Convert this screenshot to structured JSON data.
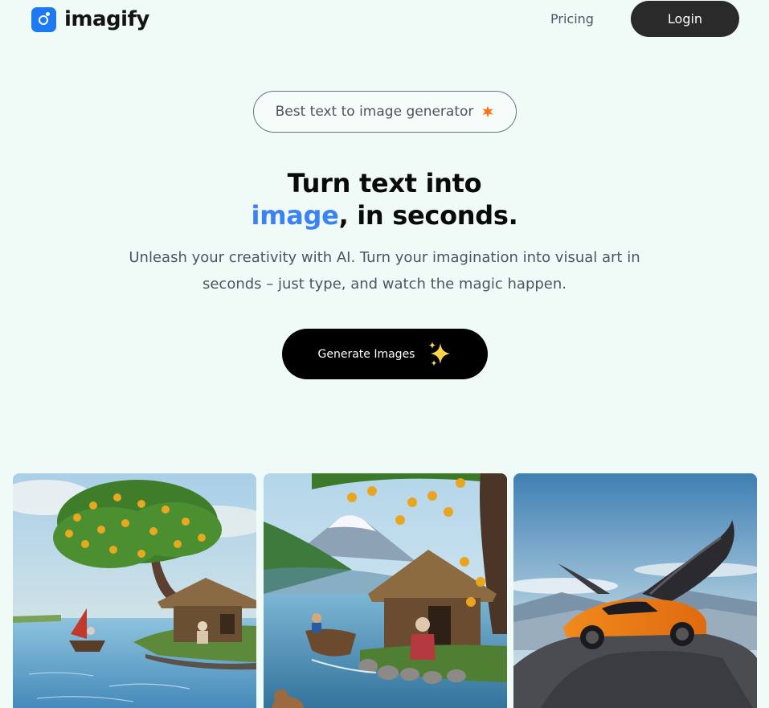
{
  "header": {
    "logo_text": "imagify",
    "nav_pricing": "Pricing",
    "login_label": "Login"
  },
  "badge": {
    "text": "Best text to image generator",
    "icon": "star-icon"
  },
  "hero": {
    "title_line1": "Turn text into",
    "title_accent": "image",
    "title_rest": ", in seconds.",
    "subtitle": "Unleash your creativity with AI. Turn your imagination into visual art in seconds – just type, and watch the magic happen.",
    "cta_label": "Generate Images",
    "cta_icon": "sparkle-icon"
  },
  "gallery": {
    "images": [
      {
        "subject": "mango tree, hut and boat on a lake"
      },
      {
        "subject": "old woman at thatched hut by mountain lake"
      },
      {
        "subject": "winged orange sports car on a cliff"
      }
    ]
  },
  "colors": {
    "background": "#f0fbf8",
    "accent": "#3b82f6",
    "logo_blue": "#1d7af2",
    "button_dark": "#2a2a2a",
    "badge_star": "#f97316"
  }
}
